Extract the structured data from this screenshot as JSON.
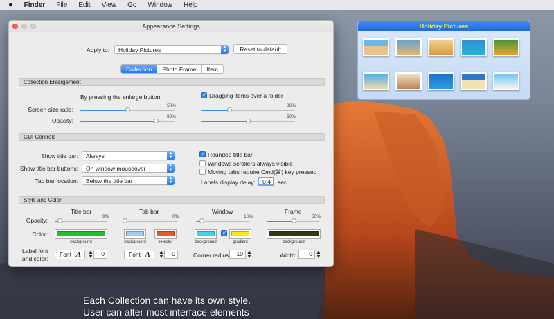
{
  "menubar": {
    "apple": "",
    "items": [
      "Finder",
      "File",
      "Edit",
      "View",
      "Go",
      "Window",
      "Help"
    ]
  },
  "window": {
    "title": "Appearance Settings",
    "apply_to_label": "Apply to:",
    "apply_to_value": "Holiday Pictures",
    "reset_label": "Reset to default",
    "tabs": [
      {
        "label": "Collection",
        "active": true
      },
      {
        "label": "Photo Frame",
        "active": false
      },
      {
        "label": "Item",
        "active": false
      }
    ],
    "enlargement": {
      "heading": "Collection Enlargement",
      "by_enlarge_label": "By pressing the enlarge button",
      "dragging_label": "Dragging items over a folder",
      "dragging_checked": true,
      "screen_ratio_label": "Screen size ratio:",
      "opacity_label": "Opacity:",
      "left_ratio": "50%",
      "left_opacity": "80%",
      "right_ratio": "30%",
      "right_opacity": "50%",
      "left_ratio_value": 0.5,
      "left_opacity_value": 0.8,
      "right_ratio_value": 0.3,
      "right_opacity_value": 0.5
    },
    "gui": {
      "heading": "GUI Controls",
      "show_title_bar_label": "Show title bar:",
      "show_title_bar_value": "Always",
      "show_title_buttons_label": "Show title bar buttons:",
      "show_title_buttons_value": "On window mouseover",
      "tab_bar_location_label": "Tab bar location:",
      "tab_bar_location_value": "Below the title bar",
      "rounded_label": "Rounded title bar",
      "rounded_checked": true,
      "scrollers_label": "Windows scrollers always visible",
      "scrollers_checked": false,
      "moving_tabs_label": "Moving tabs require Cmd(⌘) key pressed",
      "moving_tabs_checked": false,
      "labels_delay_label": "Labels display delay:",
      "labels_delay_value": "0,4",
      "labels_delay_unit": "sec."
    },
    "style": {
      "heading": "Style and Color",
      "opacity_label": "Opacity:",
      "color_label": "Color:",
      "label_font_label": "Label font\nand color:",
      "columns": [
        {
          "title": "Title bar",
          "opacity": "9%",
          "opacity_value": 0.09
        },
        {
          "title": "Tab bar",
          "opacity": "0%",
          "opacity_value": 0.0
        },
        {
          "title": "Window",
          "opacity": "10%",
          "opacity_value": 0.1
        },
        {
          "title": "Frame",
          "opacity": "50%",
          "opacity_value": 0.5
        }
      ],
      "swatches": [
        {
          "label": "background",
          "color": "#21bf33"
        },
        {
          "label": "background",
          "color": "#9ccbee"
        },
        {
          "label": "selector",
          "color": "#e5582c"
        },
        {
          "label": "background",
          "color": "#3ad3f0"
        },
        {
          "label": "gradient",
          "color": "#f5ea14"
        },
        {
          "label": "background",
          "color": "#313a12"
        }
      ],
      "gradient_checked": true,
      "font_label": "Font",
      "font_glyph": "A",
      "title_font_size": "0",
      "tab_font_size": "0",
      "corner_radius_label": "Corner radius:",
      "corner_radius_value": "10",
      "width_label": "Width:",
      "width_value": "0"
    }
  },
  "holiday": {
    "title": "Holiday Pictures"
  },
  "caption": {
    "line1": "Each Collection can have its own style.",
    "line2": "User can alter most interface elements"
  }
}
